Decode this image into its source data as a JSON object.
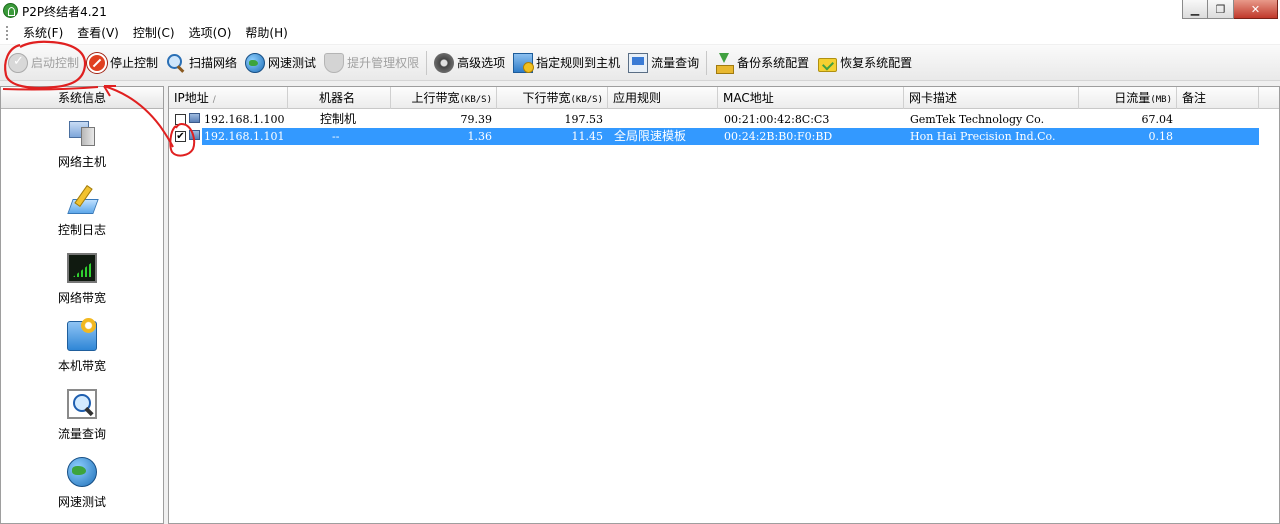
{
  "window": {
    "title": "P2P终结者4.21"
  },
  "menu": [
    "系统(F)",
    "查看(V)",
    "控制(C)",
    "选项(O)",
    "帮助(H)"
  ],
  "toolbar": {
    "start": "启动控制",
    "stop": "停止控制",
    "scan": "扫描网络",
    "speedtest": "网速测试",
    "elevate": "提升管理权限",
    "advanced": "高级选项",
    "assign_rule": "指定规则到主机",
    "flow_query": "流量查询",
    "backup": "备份系统配置",
    "restore": "恢复系统配置"
  },
  "sidebar": {
    "header": "系统信息",
    "items": [
      {
        "label": "网络主机",
        "icon": "network-host-icon"
      },
      {
        "label": "控制日志",
        "icon": "control-log-icon"
      },
      {
        "label": "网络带宽",
        "icon": "network-bandwidth-icon"
      },
      {
        "label": "本机带宽",
        "icon": "local-bandwidth-icon"
      },
      {
        "label": "流量查询",
        "icon": "flow-query-icon"
      },
      {
        "label": "网速测试",
        "icon": "speed-test-icon"
      }
    ]
  },
  "table": {
    "columns": {
      "ip": "IP地址",
      "name": "机器名",
      "up": "上行带宽",
      "up_unit": "(KB/S)",
      "down": "下行带宽",
      "down_unit": "(KB/S)",
      "rule": "应用规则",
      "mac": "MAC地址",
      "nic": "网卡描述",
      "daily": "日流量",
      "daily_unit": "(MB)",
      "note": "备注"
    },
    "rows": [
      {
        "checked": false,
        "ip": "192.168.1.100",
        "name": "控制机",
        "up": "79.39",
        "down": "197.53",
        "rule": "",
        "mac": "00:21:00:42:8C:C3",
        "nic": "GemTek Technology Co.",
        "daily": "67.04",
        "note": "",
        "selected": false
      },
      {
        "checked": true,
        "ip": "192.168.1.101",
        "name": "--",
        "up": "1.36",
        "down": "11.45",
        "rule": "全局限速模板",
        "mac": "00:24:2B:B0:F0:BD",
        "nic": "Hon Hai Precision Ind.Co.",
        "daily": "0.18",
        "note": "",
        "selected": true
      }
    ]
  },
  "colors": {
    "selection": "#3399ff",
    "annotation": "#e02020"
  }
}
